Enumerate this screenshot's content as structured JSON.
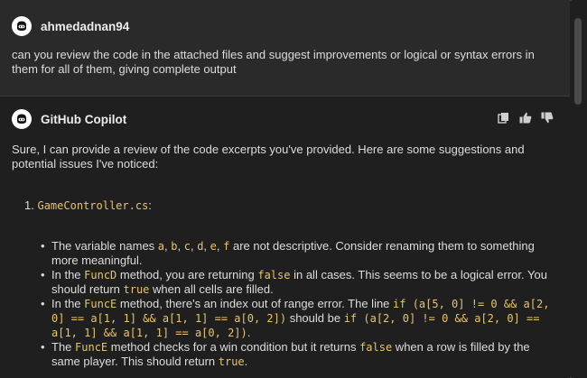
{
  "user_message": {
    "author": "ahmedadnan94",
    "text": "can you review the code in the attached files and suggest improvements or logical or syntax errors in them for all of them, giving complete output"
  },
  "assistant_message": {
    "author": "GitHub Copilot",
    "intro": "Sure, I can provide a review of the code excerpts you've provided. Here are some suggestions and potential issues I've noticed:",
    "item_number": "1.",
    "item_file": "GameController.cs",
    "item_colon": ":",
    "bullets": {
      "b1_pre": "The variable names ",
      "b1_a": "a",
      "b1_sep1": ", ",
      "b1_b": "b",
      "b1_sep2": ", ",
      "b1_c": "c",
      "b1_sep3": ", ",
      "b1_d": "d",
      "b1_sep4": ", ",
      "b1_e": "e",
      "b1_sep5": ", ",
      "b1_f": "f",
      "b1_post": " are not descriptive. Consider renaming them to something more meaningful.",
      "b2_pre": "In the ",
      "b2_code1": "FuncD",
      "b2_mid": " method, you are returning ",
      "b2_code2": "false",
      "b2_mid2": " in all cases. This seems to be a logical error. You should return ",
      "b2_code3": "true",
      "b2_post": " when all cells are filled.",
      "b3_pre": "In the ",
      "b3_code1": "FuncE",
      "b3_mid": " method, there's an index out of range error. The line ",
      "b3_code2": "if (a[5, 0] != 0 && a[2, 0] == a[1, 1] && a[1, 1] == a[0, 2])",
      "b3_mid2": " should be ",
      "b3_code3": "if (a[2, 0] != 0 && a[2, 0] == a[1, 1] && a[1, 1] == a[0, 2])",
      "b3_post": ".",
      "b4_pre": "The ",
      "b4_code1": "FuncE",
      "b4_mid": " method checks for a win condition but it returns ",
      "b4_code2": "false",
      "b4_mid2": " when a row is filled by the same player. This should return ",
      "b4_code3": "true",
      "b4_post": "."
    }
  },
  "icons": {
    "user_avatar": "copilot-avatar-icon",
    "assistant_avatar": "copilot-avatar-icon",
    "copy": "copy-icon",
    "thumbs_up": "thumbs-up-icon",
    "thumbs_down": "thumbs-down-icon"
  },
  "colors": {
    "code": "#e8c46b",
    "user_bg": "#2a2a2b",
    "assistant_bg": "#1f1f1f"
  }
}
